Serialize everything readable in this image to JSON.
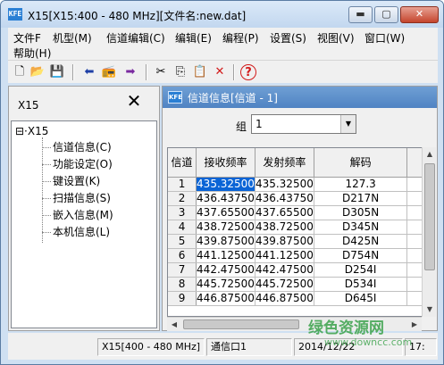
{
  "window": {
    "title": "X15[X15:400 - 480 MHz][文件名:new.dat]",
    "icon_text": "KFE",
    "min_glyph": "▬",
    "max_glyph": "▢",
    "close_glyph": "✕"
  },
  "menu": {
    "items": [
      "文件F",
      "机型(M)",
      "信道编辑(C)",
      "编辑(E)",
      "编程(P)",
      "设置(S)",
      "视图(V)",
      "窗口(W)",
      "帮助(H)"
    ]
  },
  "toolbar": {
    "icons": [
      "new-file-icon",
      "open-folder-icon",
      "save-icon",
      "arrow-left-icon",
      "radio-transfer-icon",
      "arrow-right-icon",
      "cut-icon",
      "copy-icon",
      "paste-icon",
      "delete-icon",
      "help-icon"
    ],
    "glyphs": {
      "new": "🗋",
      "open": "📂",
      "save": "💾",
      "read": "⬅",
      "radio": "📻",
      "write": "➡",
      "cut": "✂",
      "copy": "⎘",
      "paste": "📋",
      "delete": "✕",
      "help": "?"
    }
  },
  "left_panel": {
    "title": "X15",
    "close_glyph": "✕",
    "tree_root": "⊟·X15",
    "tree_items": [
      "信道信息(C)",
      "功能设定(O)",
      "键设置(K)",
      "扫描信息(S)",
      "嵌入信息(M)",
      "本机信息(L)"
    ]
  },
  "right_panel": {
    "title": "信道信息[信道 - 1]",
    "icon_text": "KFE",
    "group_label": "组",
    "group_value": "1",
    "dropdown_glyph": "▼",
    "columns": [
      "信道",
      "接收频率",
      "发射频率",
      "解码"
    ],
    "rows": [
      [
        "1",
        "435.32500",
        "435.32500",
        "127.3"
      ],
      [
        "2",
        "436.43750",
        "436.43750",
        "D217N"
      ],
      [
        "3",
        "437.65500",
        "437.65500",
        "D305N"
      ],
      [
        "4",
        "438.72500",
        "438.72500",
        "D345N"
      ],
      [
        "5",
        "439.87500",
        "439.87500",
        "D425N"
      ],
      [
        "6",
        "441.12500",
        "441.12500",
        "D754N"
      ],
      [
        "7",
        "442.47500",
        "442.47500",
        "D254I"
      ],
      [
        "8",
        "445.72500",
        "445.72500",
        "D534I"
      ],
      [
        "9",
        "446.87500",
        "446.87500",
        "D645I"
      ]
    ],
    "selected_cell": {
      "row": 0,
      "col": 1
    },
    "scroll_up": "▲",
    "scroll_down": "▼",
    "scroll_left": "◀",
    "scroll_right": "▶"
  },
  "statusbar": {
    "model": "X15[400 - 480 MHz]",
    "port": "通信口1",
    "date": "2014/12/22",
    "time": "17:"
  },
  "watermark": {
    "cn": "绿色资源网",
    "url": "www.downcc.com"
  }
}
